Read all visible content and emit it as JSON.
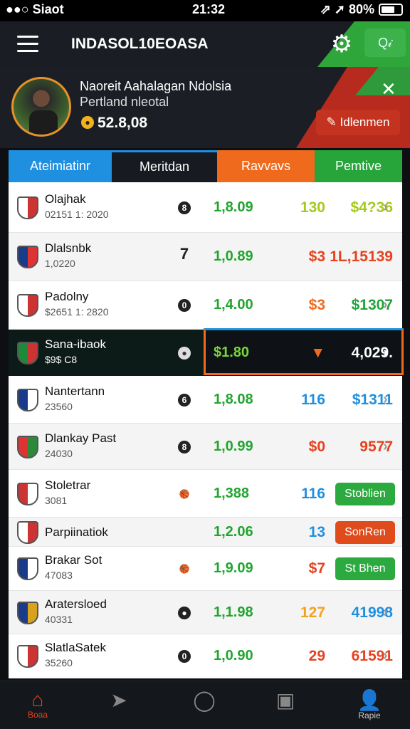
{
  "status": {
    "left": "●●○ Siaot",
    "time": "21:32",
    "right": "⇗ ➚ 80%"
  },
  "header": {
    "title": "INDASOL10EOASA",
    "q_label": "Q𝒾"
  },
  "profile": {
    "name": "Naoreit Aahalagan Ndolsia",
    "subtitle": "Pertland nleotal",
    "balance": "52.8,08",
    "coin_glyph": "●",
    "action_label": "✎ Idlenmen"
  },
  "tabs": [
    {
      "label": "Ateimiatinr"
    },
    {
      "label": "Meritdan"
    },
    {
      "label": "Ravvavs"
    },
    {
      "label": "Pemtive"
    }
  ],
  "rows": [
    {
      "name": "Olajhak",
      "sub": "02151 1: 2020",
      "icon": "8",
      "odd": "1,8.09",
      "mid": "130",
      "mid_color": "#a6c91e",
      "value": "$4?36",
      "value_color": "#a6c91e",
      "chev": "›"
    },
    {
      "name": "Dlalsnbk",
      "sub": "1,0220",
      "icon": "7",
      "odd": "1,0.89",
      "mid": "$3",
      "mid_color": "#e5421f",
      "value": "1L,15139",
      "value_color": "#e5421f",
      "chev": ""
    },
    {
      "name": "Padolny",
      "sub": "$2651 1: 2820",
      "icon": "0",
      "odd": "1,4.00",
      "mid": "$3",
      "mid_color": "#f06a1d",
      "value": "$1307",
      "value_color": "#21a33a",
      "chev": "›"
    },
    {
      "name": "Sana-ibaok",
      "sub": "$9$ C8",
      "icon": "●",
      "odd": "$1.80",
      "mid": "▼",
      "mid_color": "#f06a1d",
      "value": "4,029.",
      "value_color": "#ffffff",
      "chev": "›"
    },
    {
      "name": "Nantertann",
      "sub": "23560",
      "icon": "6",
      "odd": "1,8.08",
      "mid": "116",
      "mid_color": "#1f8fe0",
      "value": "$1311",
      "value_color": "#1f8fe0",
      "chev": "›"
    },
    {
      "name": "Dlankay Past",
      "sub": "24030",
      "icon": "8",
      "odd": "1,0.99",
      "mid": "$0",
      "mid_color": "#e5421f",
      "value": "9577",
      "value_color": "#e5421f",
      "chev": "›"
    },
    {
      "name": "Stoletrar",
      "sub": "3081",
      "icon": "🏀",
      "odd": "1,388",
      "mid": "116",
      "mid_color": "#1f8fe0",
      "pill": "Stoblien",
      "pill_color": "#2daa3f"
    },
    {
      "name": "Parpiinatiok",
      "sub": "",
      "icon": "",
      "odd": "1,2.06",
      "mid": "13",
      "mid_color": "#1f8fe0",
      "pill": "SonRen",
      "pill_color": "#e04b1c"
    },
    {
      "name": "Brakar Sot",
      "sub": "47083",
      "icon": "🏀",
      "odd": "1,9.09",
      "mid": "$7",
      "mid_color": "#e5421f",
      "pill": "St Bhen",
      "pill_color": "#2daa3f"
    },
    {
      "name": "Aratersloed",
      "sub": "40331",
      "icon": "●",
      "odd": "1,1.98",
      "mid": "127",
      "mid_color": "#f2a21b",
      "value": "41998",
      "value_color": "#1f8fe0",
      "chev": "›"
    },
    {
      "name": "SlatlaSatek",
      "sub": "35260",
      "icon": "0",
      "odd": "1,0.90",
      "mid": "29",
      "mid_color": "#e5421f",
      "value": "61591",
      "value_color": "#e5421f",
      "chev": "›"
    }
  ],
  "nav": [
    {
      "icon": "⌂",
      "label": "Boaa"
    },
    {
      "icon": "➤",
      "label": ""
    },
    {
      "icon": "◯",
      "label": ""
    },
    {
      "icon": "▣",
      "label": ""
    },
    {
      "icon": "👤",
      "label": "Rapie"
    }
  ],
  "colors": {
    "accent_blue": "#1f8fe0",
    "accent_orange": "#f06a1d",
    "accent_green": "#27a53b",
    "accent_red": "#c4331f"
  }
}
